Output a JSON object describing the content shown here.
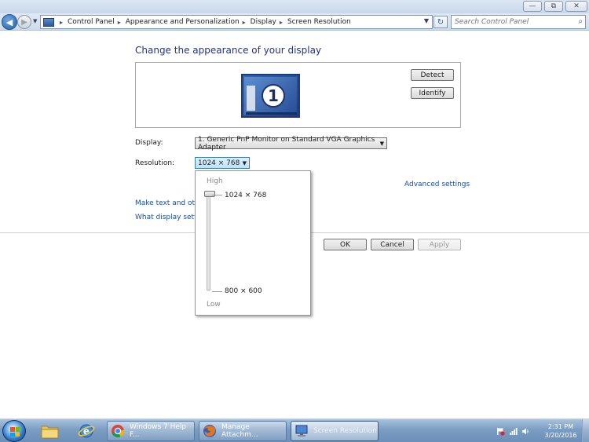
{
  "window": {
    "minimize_glyph": "—",
    "maximize_glyph": "⧉",
    "close_glyph": "✕"
  },
  "address_bar": {
    "back_glyph": "◀",
    "forward_glyph": "▶",
    "crumbs": [
      "Control Panel",
      "Appearance and Personalization",
      "Display",
      "Screen Resolution"
    ],
    "crumb_separator": "▸",
    "dropdown_glyph": "▼",
    "refresh_glyph": "↻"
  },
  "search": {
    "placeholder": "Search Control Panel",
    "icon": "search-icon",
    "glyph": "⌕"
  },
  "main": {
    "heading": "Change the appearance of your display",
    "monitor_number": "1",
    "detect_label": "Detect",
    "identify_label": "Identify",
    "display_label": "Display:",
    "display_value": "1. Generic PnP Monitor on Standard VGA Graphics Adapter",
    "resolution_label": "Resolution:",
    "resolution_value": "1024 × 768",
    "advanced_link": "Advanced settings",
    "link1": "Make text and other",
    "link2": "What display setting",
    "ok_label": "OK",
    "cancel_label": "Cancel",
    "apply_label": "Apply"
  },
  "resolution_popup": {
    "high_label": "High",
    "low_label": "Low",
    "top_option": "1024 × 768",
    "bottom_option": "800 × 600",
    "slider_level": 1.0
  },
  "taskbar": {
    "items": [
      {
        "label": "Windows 7 Help F...",
        "icon": "chrome-icon"
      },
      {
        "label": "Manage Attachm...",
        "icon": "firefox-icon"
      },
      {
        "label": "Screen Resolution",
        "icon": "display-icon"
      }
    ],
    "clock_time": "2:31 PM",
    "clock_date": "3/20/2016"
  }
}
